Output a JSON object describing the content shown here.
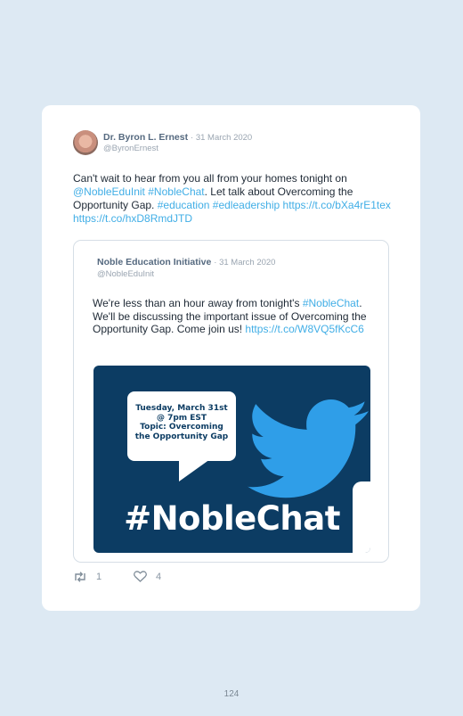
{
  "tweet": {
    "author": "Dr. Byron L. Ernest",
    "date": "· 31 March 2020",
    "handle": "@ByronErnest",
    "text": {
      "p1": "Can't wait to hear from you all from your homes tonight on ",
      "mention": "@NobleEduInit",
      "p2": " ",
      "tag1": "#NobleChat",
      "p3": ". Let talk about Overcoming the Opportunity Gap. ",
      "tag2": "#education",
      "p4": " ",
      "tag3": "#edleadership",
      "p5": " ",
      "link1": "https://t.co/bXa4rE1tex",
      "p6": " ",
      "link2": "https://t.co/hxD8RmdJTD"
    },
    "retweets": "1",
    "likes": "4"
  },
  "quote": {
    "author": "Noble Education Initiative",
    "date": "· 31 March 2020",
    "handle": "@NobleEduInit",
    "text": {
      "p1": "We're less than an hour away from tonight's ",
      "tag": "#NobleChat",
      "p2": ". We'll be discussing the important issue of Overcoming the Opportunity Gap. Come join us! ",
      "link": "https://t.co/W8VQ5fKcC6"
    },
    "image": {
      "line1": "Tuesday, March 31st",
      "line2": "@ 7pm EST",
      "line3": "Topic: Overcoming",
      "line4": "the Opportunity Gap",
      "hashtag": "#NobleChat"
    }
  },
  "icons": {
    "retweet": "retweet-icon",
    "like": "heart-icon",
    "bird": "twitter-bird-icon"
  },
  "colors": {
    "page": "#dde9f3",
    "link": "#41aee6",
    "media_bg": "#0c3c63",
    "bird": "#2f9ee8"
  },
  "page_number": "124"
}
